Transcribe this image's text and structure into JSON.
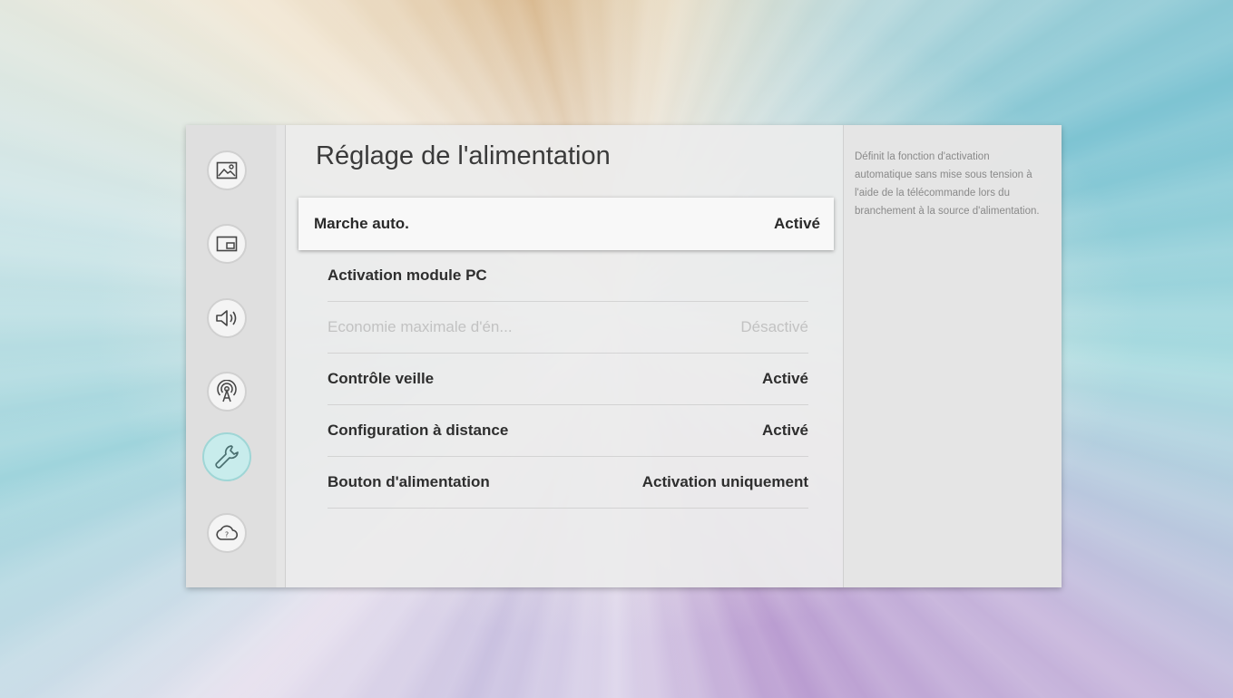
{
  "menu": {
    "title": "Réglage de l'alimentation",
    "items": [
      {
        "label": "Marche auto.",
        "value": "Activé",
        "state": "focused"
      },
      {
        "label": "Activation module PC",
        "value": "",
        "state": "normal"
      },
      {
        "label": "Economie maximale d'én...",
        "value": "Désactivé",
        "state": "disabled"
      },
      {
        "label": "Contrôle veille",
        "value": "Activé",
        "state": "normal"
      },
      {
        "label": "Configuration à distance",
        "value": "Activé",
        "state": "normal"
      },
      {
        "label": "Bouton d'alimentation",
        "value": "Activation uniquement",
        "state": "normal"
      }
    ]
  },
  "sidebar": {
    "items": [
      {
        "icon": "picture-icon"
      },
      {
        "icon": "picture-in-picture-icon"
      },
      {
        "icon": "sound-icon"
      },
      {
        "icon": "broadcast-icon"
      },
      {
        "icon": "wrench-icon",
        "active": true
      },
      {
        "icon": "support-icon"
      }
    ]
  },
  "help": {
    "text": "Définit la fonction d'activation automatique sans mise sous tension à l'aide de la télécommande lors du branchement à la source d'alimentation."
  },
  "colors": {
    "active_icon_bg": "#c8ecec",
    "focused_row_bg": "#f8f8f8",
    "panel_bg": "#ececec"
  }
}
